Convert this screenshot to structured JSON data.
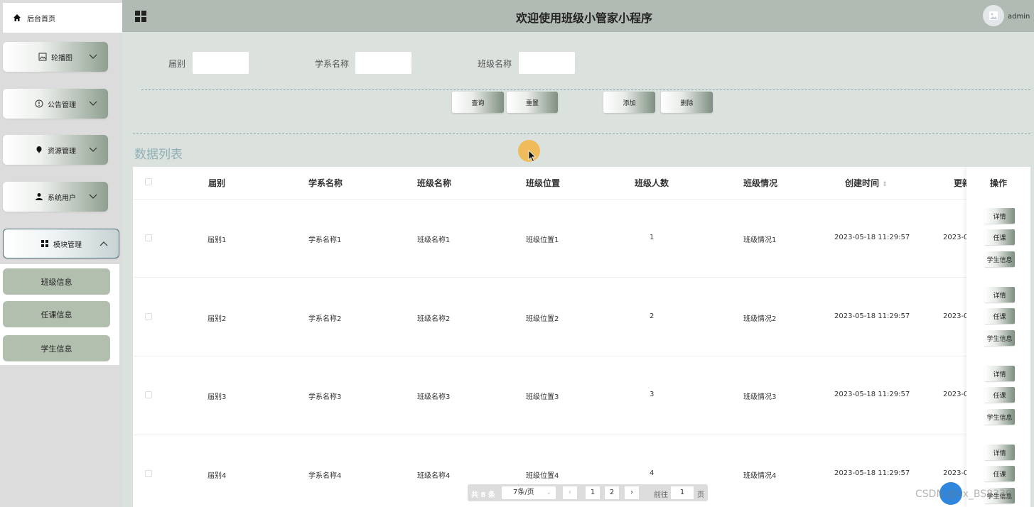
{
  "sidebar": {
    "home_label": "后台首页",
    "menus": [
      {
        "label": "轮播图",
        "icon": "image-icon"
      },
      {
        "label": "公告管理",
        "icon": "info-circle-icon"
      },
      {
        "label": "资源管理",
        "icon": "balloon-icon"
      },
      {
        "label": "系统用户",
        "icon": "user-icon"
      },
      {
        "label": "模块管理",
        "icon": "grid-icon"
      }
    ],
    "submenu": [
      "班级信息",
      "任课信息",
      "学生信息"
    ]
  },
  "header": {
    "title": "欢迎使用班级小管家小程序",
    "user": "admin"
  },
  "search": {
    "labels": [
      "届别",
      "学系名称",
      "班级名称"
    ]
  },
  "actions": {
    "query": "查询",
    "reset": "重置",
    "add": "添加",
    "delete": "删除"
  },
  "list_title": "数据列表",
  "table": {
    "headers": [
      "届别",
      "学系名称",
      "班级名称",
      "班级位置",
      "班级人数",
      "班级情况",
      "创建时间",
      "更新",
      "操作"
    ],
    "rows": [
      {
        "jiebie": "届别1",
        "xuexi": "学系名称1",
        "banji": "班级名称1",
        "weizhi": "班级位置1",
        "renshu": "1",
        "qingkuang": "班级情况1",
        "created": "2023-05-18 11:29:57",
        "updated": "2023-0"
      },
      {
        "jiebie": "届别2",
        "xuexi": "学系名称2",
        "banji": "班级名称2",
        "weizhi": "班级位置2",
        "renshu": "2",
        "qingkuang": "班级情况2",
        "created": "2023-05-18 11:29:57",
        "updated": "2023-0"
      },
      {
        "jiebie": "届别3",
        "xuexi": "学系名称3",
        "banji": "班级名称3",
        "weizhi": "班级位置3",
        "renshu": "3",
        "qingkuang": "班级情况3",
        "created": "2023-05-18 11:29:57",
        "updated": "2023-0"
      },
      {
        "jiebie": "届别4",
        "xuexi": "学系名称4",
        "banji": "班级名称4",
        "weizhi": "班级位置4",
        "renshu": "4",
        "qingkuang": "班级情况4",
        "created": "2023-05-18 11:29:57",
        "updated": "2023-0"
      }
    ],
    "op_labels": {
      "detail": "详情",
      "course": "任课",
      "student": "学生信息"
    }
  },
  "pagination": {
    "total": "共 8 条",
    "page_size": "7条/页",
    "pages": [
      "1",
      "2"
    ],
    "goto_label": "前往",
    "goto_value": "1",
    "unit": "页"
  },
  "watermark": "CSDN @vx_BS8330"
}
